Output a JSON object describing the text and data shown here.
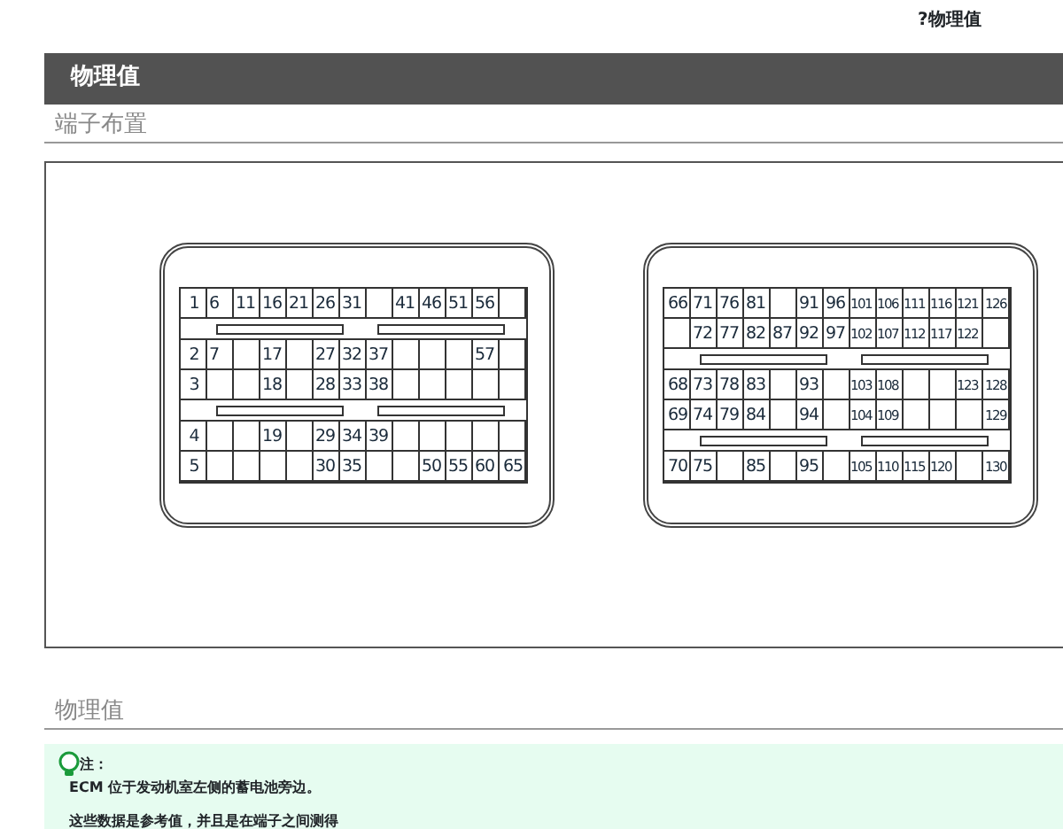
{
  "top_link": "?物理值",
  "title_bar": "物理值",
  "section_1": {
    "heading": "端子布置",
    "connectors": [
      {
        "rows": [
          {
            "kind": "pins",
            "cells": [
              "1",
              "6",
              "11",
              "16",
              "21",
              "26",
              "31",
              null,
              "41",
              "46",
              "51",
              "56",
              null
            ]
          },
          {
            "kind": "bar"
          },
          {
            "kind": "pins",
            "cells": [
              "2",
              "7",
              null,
              "17",
              null,
              "27",
              "32",
              "37",
              null,
              null,
              null,
              "57",
              null
            ]
          },
          {
            "kind": "pins",
            "cells": [
              "3",
              null,
              null,
              "18",
              null,
              "28",
              "33",
              "38",
              null,
              null,
              null,
              null,
              null
            ]
          },
          {
            "kind": "bar"
          },
          {
            "kind": "pins",
            "cells": [
              "4",
              null,
              null,
              "19",
              null,
              "29",
              "34",
              "39",
              null,
              null,
              null,
              null,
              null
            ]
          },
          {
            "kind": "pins",
            "cells": [
              "5",
              null,
              null,
              null,
              null,
              "30",
              "35",
              null,
              null,
              "50",
              "55",
              "60",
              "65"
            ]
          }
        ]
      },
      {
        "rows": [
          {
            "kind": "pins",
            "cells": [
              "66",
              "71",
              "76",
              "81",
              null,
              "91",
              "96",
              "101",
              "106",
              "111",
              "116",
              "121",
              "126"
            ]
          },
          {
            "kind": "pins",
            "cells": [
              null,
              "72",
              "77",
              "82",
              "87",
              "92",
              "97",
              "102",
              "107",
              "112",
              "117",
              "122",
              null
            ]
          },
          {
            "kind": "bar"
          },
          {
            "kind": "pins",
            "cells": [
              "68",
              "73",
              "78",
              "83",
              null,
              "93",
              null,
              "103",
              "108",
              null,
              null,
              "123",
              "128"
            ]
          },
          {
            "kind": "pins",
            "cells": [
              "69",
              "74",
              "79",
              "84",
              null,
              "94",
              null,
              "104",
              "109",
              null,
              null,
              null,
              "129"
            ]
          },
          {
            "kind": "bar"
          },
          {
            "kind": "pins",
            "cells": [
              "70",
              "75",
              null,
              "85",
              null,
              "95",
              null,
              "105",
              "110",
              "115",
              "120",
              null,
              "130"
            ]
          }
        ]
      }
    ]
  },
  "section_2": {
    "heading": "物理值",
    "note": {
      "label": "注：",
      "lines": [
        "ECM 位于发动机室左侧的蓄电池旁边。",
        "这些数据是参考值，并且是在端子之间测得"
      ]
    }
  }
}
